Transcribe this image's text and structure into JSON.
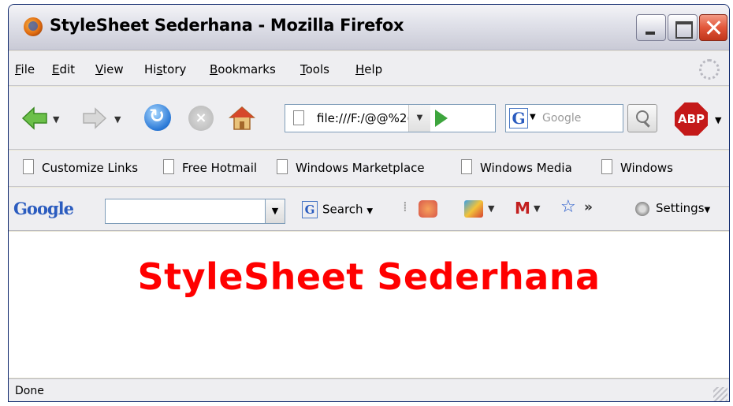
{
  "window": {
    "title": "StyleSheet Sederhana - Mozilla Firefox"
  },
  "menu": {
    "items": [
      {
        "label": "File",
        "underline": "F",
        "rest": "ile"
      },
      {
        "label": "Edit",
        "underline": "E",
        "rest": "dit"
      },
      {
        "label": "View",
        "underline": "V",
        "rest": "iew"
      },
      {
        "label": "History",
        "pre": "Hi",
        "underline": "s",
        "rest": "tory"
      },
      {
        "label": "Bookmarks",
        "underline": "B",
        "rest": "ookmarks"
      },
      {
        "label": "Tools",
        "underline": "T",
        "rest": "ools"
      },
      {
        "label": "Help",
        "underline": "H",
        "rest": "elp"
      }
    ]
  },
  "navigation": {
    "url": "file:///F:/@@%2(",
    "search_engine_letter": "G",
    "search_placeholder": "Google",
    "adblock_label": "ABP"
  },
  "bookmarks": {
    "items": [
      "Customize Links",
      "Free Hotmail",
      "Windows Marketplace",
      "Windows Media",
      "Windows"
    ]
  },
  "google_toolbar": {
    "logo": "Google",
    "search_label": "Search",
    "more_label": "»",
    "settings_label": "Settings"
  },
  "content": {
    "heading": "StyleSheet Sederhana"
  },
  "status": {
    "text": "Done"
  },
  "colors": {
    "heading": "#ff0000",
    "title_bar": "#dcdde6",
    "chrome": "#eeeef1"
  },
  "icons": [
    "firefox-icon",
    "back-icon",
    "forward-icon",
    "reload-icon",
    "stop-icon",
    "home-icon",
    "page-icon",
    "go-icon",
    "search-magnifier-icon",
    "adblock-icon",
    "gear-icon",
    "gmail-icon",
    "star-icon"
  ]
}
